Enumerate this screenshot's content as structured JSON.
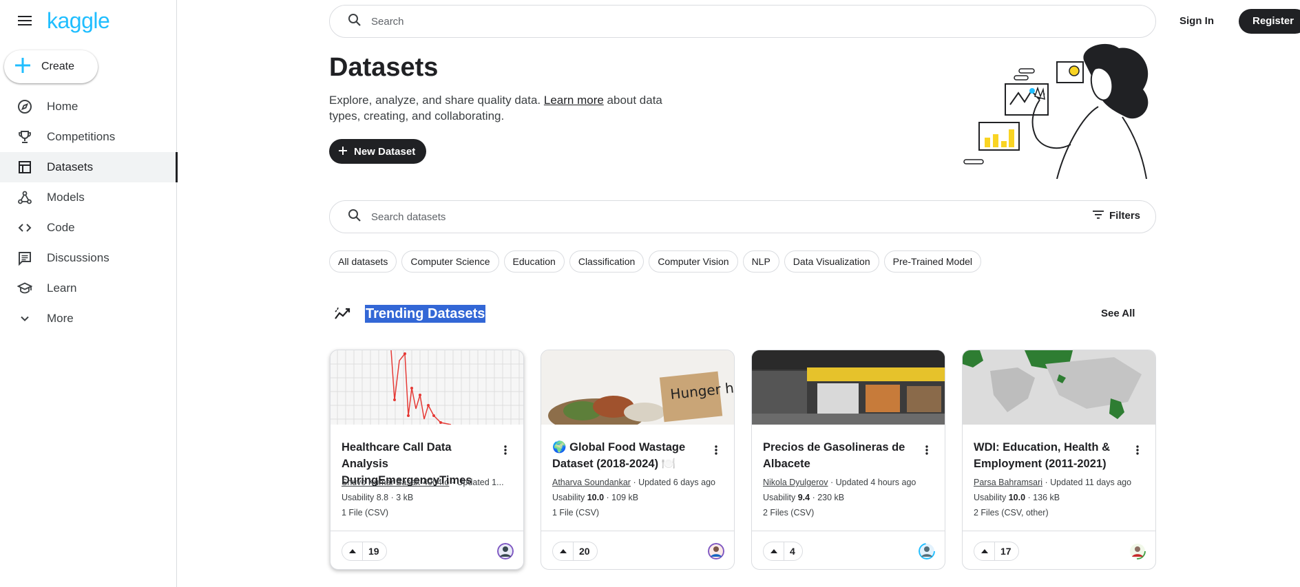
{
  "app": {
    "logo": "kaggle"
  },
  "sidebar": {
    "create_label": "Create",
    "items": [
      {
        "label": "Home",
        "icon": "compass-icon"
      },
      {
        "label": "Competitions",
        "icon": "trophy-icon"
      },
      {
        "label": "Datasets",
        "icon": "table-icon",
        "active": true
      },
      {
        "label": "Models",
        "icon": "models-icon"
      },
      {
        "label": "Code",
        "icon": "code-icon"
      },
      {
        "label": "Discussions",
        "icon": "comments-icon"
      },
      {
        "label": "Learn",
        "icon": "school-icon"
      },
      {
        "label": "More",
        "icon": "chevron-down-icon"
      }
    ]
  },
  "header": {
    "search_placeholder": "Search",
    "sign_in": "Sign In",
    "register": "Register"
  },
  "hero": {
    "title": "Datasets",
    "desc_before": "Explore, analyze, and share quality data. ",
    "desc_link": "Learn more",
    "desc_after": " about data types, creating, and collaborating.",
    "new_dataset": "New Dataset"
  },
  "dataset_search": {
    "placeholder": "Search datasets",
    "filters": "Filters"
  },
  "chips": [
    "All datasets",
    "Computer Science",
    "Education",
    "Classification",
    "Computer Vision",
    "NLP",
    "Data Visualization",
    "Pre-Trained Model"
  ],
  "trending": {
    "title": "Trending Datasets",
    "see_all": "See All",
    "cards": [
      {
        "title": "Healthcare Call Data Analysis DuringEmergencyTimes",
        "author": "Shuvo Kumar Basak-4004.o",
        "updated": " · Updated 1...",
        "usability_label": "Usability ",
        "usability": "8.8",
        "size": " · 3 kB",
        "files": "1 File (CSV)",
        "votes": "19"
      },
      {
        "title": "🌍 Global Food Wastage Dataset (2018-2024) 🍽️",
        "author": "Atharva Soundankar",
        "updated": " · Updated 6 days ago",
        "usability_label": "Usability ",
        "usability": "10.0",
        "size": " · 109 kB",
        "files": "1 File (CSV)",
        "votes": "20"
      },
      {
        "title": "Precios de Gasolineras de Albacete",
        "author": "Nikola Dyulgerov",
        "updated": " · Updated 4 hours ago",
        "usability_label": "Usability ",
        "usability": "9.4",
        "size": " · 230 kB",
        "files": "2 Files (CSV)",
        "votes": "4"
      },
      {
        "title": "WDI: Education, Health & Employment (2011-2021)",
        "author": "Parsa Bahramsari",
        "updated": " · Updated 11 days ago",
        "usability_label": "Usability ",
        "usability": "10.0",
        "size": " · 136 kB",
        "files": "2 Files (CSV, other)",
        "votes": "17"
      }
    ]
  },
  "thumbnail_text": {
    "food_sign": "Hunger has no"
  },
  "colors": {
    "brand": "#20beff",
    "dark": "#202124",
    "highlight": "#3367d6"
  }
}
